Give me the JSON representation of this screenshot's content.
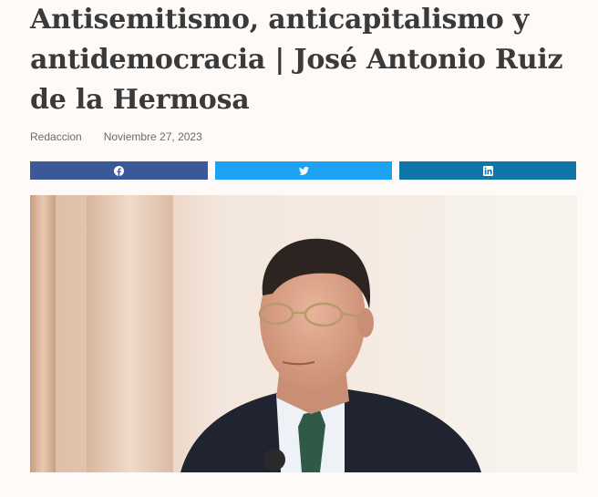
{
  "article": {
    "title": "Antisemitismo, anticapitalismo y antidemocracia | José Antonio Ruiz de la Hermosa",
    "author": "Redaccion",
    "date": "Noviembre 27, 2023"
  },
  "share": {
    "facebook_icon": "facebook-icon",
    "twitter_icon": "twitter-icon",
    "linkedin_icon": "linkedin-icon",
    "colors": {
      "facebook": "#3b5998",
      "twitter": "#1da1f2",
      "linkedin": "#0e76a8"
    }
  }
}
